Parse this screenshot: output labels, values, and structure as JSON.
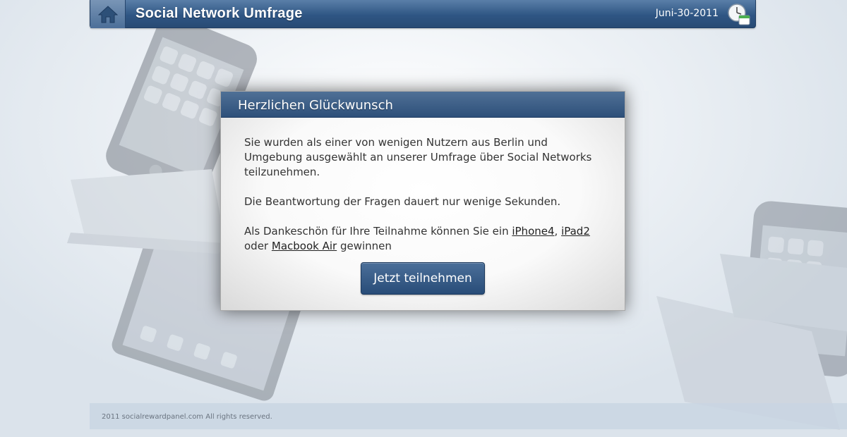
{
  "header": {
    "title": "Social Network Umfrage",
    "date": "Juni-30-2011",
    "home_icon": "home-icon",
    "clock_icon": "clock-calendar-icon"
  },
  "dialog": {
    "title": "Herzlichen Glückwunsch",
    "paragraph1": "Sie wurden als einer von wenigen Nutzern aus Berlin und Umgebung ausgewählt an unserer Umfrage über Social Networks teilzunehmen.",
    "paragraph2": "Die Beantwortung der Fragen dauert nur wenige Sekunden.",
    "paragraph3": {
      "prefix": "Als Dankeschön für Ihre Teilnahme können Sie ein ",
      "link1": "iPhone4",
      "sep1": ", ",
      "link2": "iPad2",
      "sep2": " oder ",
      "link3": "Macbook Air",
      "suffix": " gewinnen"
    },
    "button_label": "Jetzt teilnehmen"
  },
  "footer": {
    "copyright": "2011 socialrewardpanel.com All rights reserved."
  },
  "colors": {
    "header_blue": "#2f5684",
    "button_blue": "#284c78",
    "background": "#e8edf2"
  }
}
